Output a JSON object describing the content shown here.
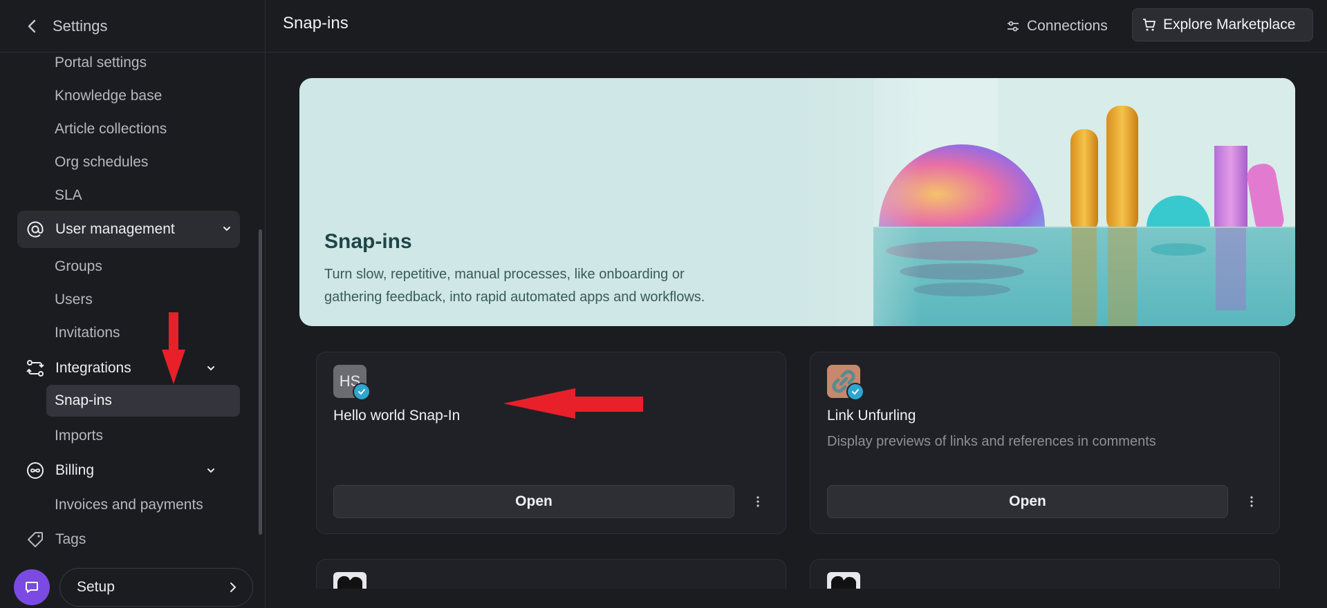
{
  "sidebar": {
    "header_title": "Settings",
    "items": [
      {
        "label": "Portal settings"
      },
      {
        "label": "Knowledge base"
      },
      {
        "label": "Article collections"
      },
      {
        "label": "Org schedules"
      },
      {
        "label": "SLA"
      },
      {
        "label": "User management"
      },
      {
        "label": "Groups"
      },
      {
        "label": "Users"
      },
      {
        "label": "Invitations"
      },
      {
        "label": "Integrations"
      },
      {
        "label": "Snap-ins"
      },
      {
        "label": "Imports"
      },
      {
        "label": "Billing"
      },
      {
        "label": "Invoices and payments"
      },
      {
        "label": "Tags"
      }
    ],
    "setup_label": "Setup"
  },
  "topbar": {
    "title": "Snap-ins",
    "connections_label": "Connections",
    "marketplace_label": "Explore Marketplace"
  },
  "hero": {
    "title": "Snap-ins",
    "description_line1": "Turn slow, repetitive, manual processes, like onboarding or",
    "description_line2": "gathering feedback, into rapid automated apps and workflows."
  },
  "cards": [
    {
      "logo_text": "HS",
      "name": "Hello world Snap-In",
      "description": "",
      "button": "Open"
    },
    {
      "logo_text": "",
      "name": "Link Unfurling",
      "description": "Display previews of links and references in comments",
      "button": "Open"
    }
  ],
  "colors": {
    "accent_purple": "#7b4ae2",
    "verified_badge": "#2fa5cf",
    "annotation_red": "#e8202a"
  }
}
